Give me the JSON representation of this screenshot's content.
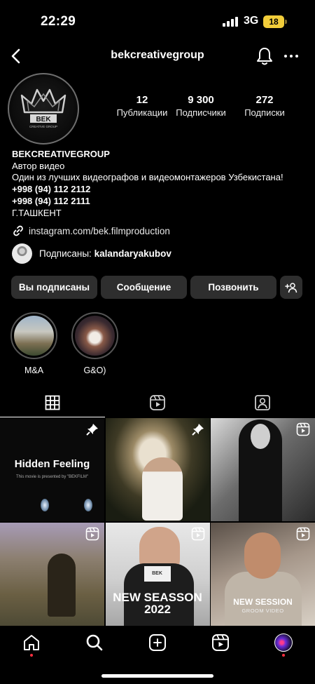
{
  "status_bar": {
    "time": "22:29",
    "network": "3G",
    "battery": "18"
  },
  "header": {
    "username": "bekcreativegroup"
  },
  "profile": {
    "logo_text": "BEK",
    "logo_subtext": "CREATIVE GROUP",
    "stats": [
      {
        "value": "12",
        "label": "Публикации"
      },
      {
        "value": "9 300",
        "label": "Подписчики"
      },
      {
        "value": "272",
        "label": "Подписки"
      }
    ],
    "name": "BEKCREATIVEGROUP",
    "category": "Автор видео",
    "bio_line": "Один из лучших видеографов и видеомонтажеров Узбекистана!",
    "phone1": "+998 (94) 112 2112",
    "phone2": "+998 (94) 112 2111",
    "city": "Г.ТАШКЕНТ",
    "link": "instagram.com/bek.filmproduction",
    "followed_by_prefix": "Подписаны:",
    "followed_by_user": "kalandaryakubov"
  },
  "actions": {
    "following": "Вы подписаны",
    "message": "Сообщение",
    "call": "Позвонить"
  },
  "highlights": [
    {
      "label": "M&A"
    },
    {
      "label": "G&O)"
    }
  ],
  "posts": {
    "p1_title": "Hidden Feeling",
    "p1_sub": "This movie is presented by \"BEKFILM\"",
    "p5_sign": "BEK",
    "p5_title": "NEW SEASSON 2022",
    "p6_title": "NEW SESSION",
    "p6_sub": "GROOM VIDEO"
  },
  "colors": {
    "background": "#000000",
    "button": "#2e2e2e",
    "battery": "#f2cd3a",
    "notification_dot": "#ff3040"
  }
}
